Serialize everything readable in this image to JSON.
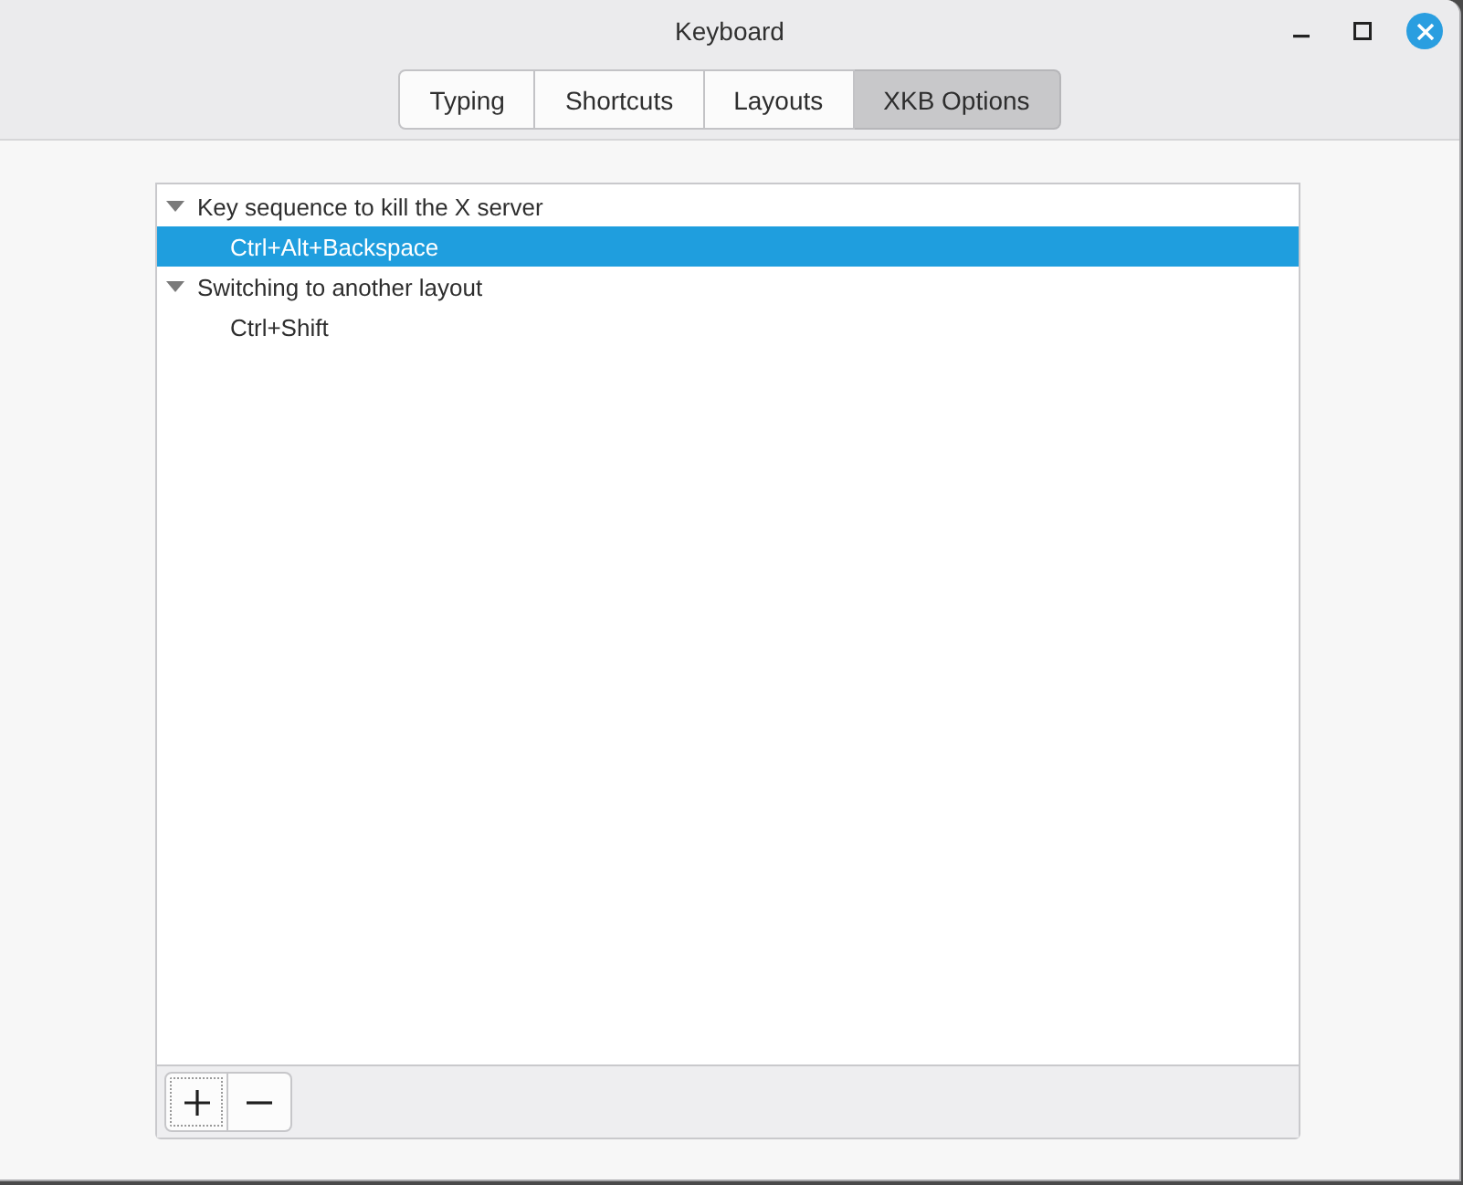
{
  "window": {
    "title": "Keyboard"
  },
  "tabs": [
    {
      "label": "Typing",
      "selected": false
    },
    {
      "label": "Shortcuts",
      "selected": false
    },
    {
      "label": "Layouts",
      "selected": false
    },
    {
      "label": "XKB Options",
      "selected": true
    }
  ],
  "tree": {
    "items": [
      {
        "label": "Key sequence to kill the X server",
        "expanded": true,
        "selected": false,
        "children": [
          {
            "label": "Ctrl+Alt+Backspace",
            "selected": true
          }
        ]
      },
      {
        "label": "Switching to another layout",
        "expanded": true,
        "selected": false,
        "children": [
          {
            "label": "Ctrl+Shift",
            "selected": false
          }
        ]
      }
    ]
  },
  "toolbar": {
    "buttons": [
      {
        "kind": "add",
        "focused": true
      },
      {
        "kind": "remove",
        "focused": false
      }
    ]
  }
}
